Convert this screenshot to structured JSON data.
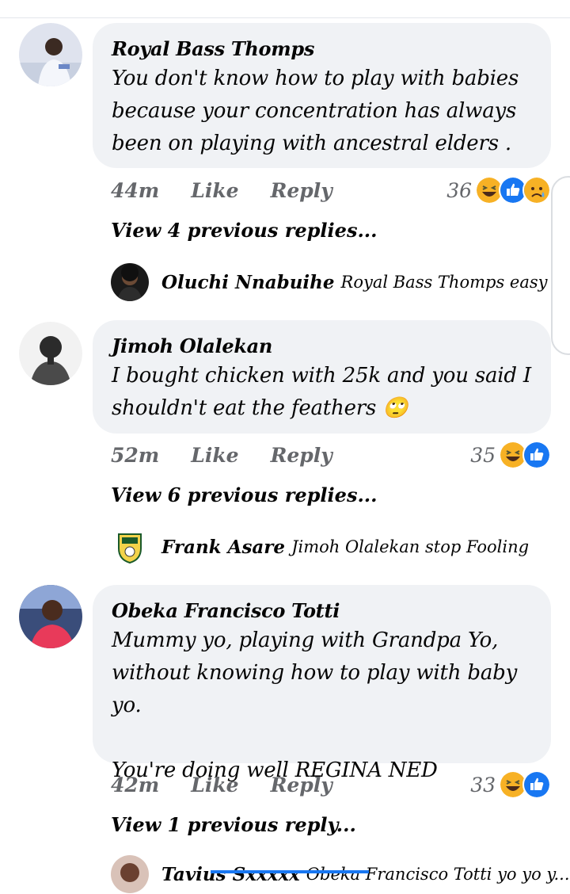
{
  "comments": [
    {
      "name": "Royal Bass Thomps",
      "text": "You don't know how to play with babies because your concentration has always been on playing with ancestral elders .",
      "time": "44m",
      "like": "Like",
      "reply": "Reply",
      "reaction_count": "36",
      "reactions": [
        "haha-icon",
        "like-icon",
        "sad-icon"
      ],
      "view_previous": "View 4 previous replies...",
      "latest_reply": {
        "name": "Oluchi Nnabuihe",
        "text": "Royal Bass Thomps easy Bi..."
      }
    },
    {
      "name": "Jimoh Olalekan",
      "text": "I bought chicken with 25k and you said I shouldn't eat the feathers 🙄",
      "time": "52m",
      "like": "Like",
      "reply": "Reply",
      "reaction_count": "35",
      "reactions": [
        "haha-icon",
        "like-icon"
      ],
      "view_previous": "View 6 previous replies...",
      "latest_reply": {
        "name": "Frank Asare",
        "text": "Jimoh Olalekan stop Fooling"
      }
    },
    {
      "name": "Obeka Francisco Totti",
      "text": "Mummy yo, playing with Grandpa Yo, without knowing how to play with baby yo.\n\nYou're doing well REGINA NED",
      "time": "42m",
      "like": "Like",
      "reply": "Reply",
      "reaction_count": "33",
      "reactions": [
        "haha-icon",
        "like-icon"
      ],
      "view_previous": "View 1 previous reply...",
      "latest_reply": {
        "name": "Tavius Sxxxxx",
        "text": "Obeka Francisco Totti yo yo y..."
      }
    }
  ],
  "colors": {
    "bubble": "#f0f2f5",
    "like_blue": "#1877f2",
    "haha_yellow": "#f7b125",
    "meta_gray": "#65676b"
  }
}
